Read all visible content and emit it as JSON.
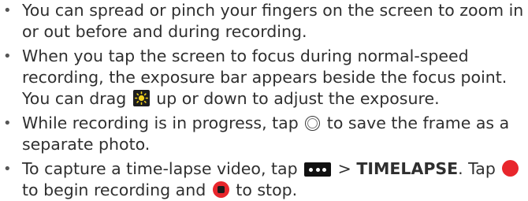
{
  "bullet_symbol": "•",
  "items": [
    {
      "text": "You can spread or pinch your fingers on the screen to zoom in or out before and during recording."
    },
    {
      "text_a": "When you tap the screen to focus during normal-speed recording, the exposure bar appears beside the focus point. You can drag",
      "icon": "exposure-sun-icon",
      "text_b": "up or down to adjust the exposure."
    },
    {
      "text_a": "While recording is in progress, tap",
      "icon": "shutter-icon",
      "text_b": "to save the frame as a separate photo."
    },
    {
      "text_a": "To capture a time-lapse video, tap",
      "icon_1": "more-icon",
      "sep": ">",
      "bold": "TIMELAPSE",
      "text_b": ". Tap",
      "icon_2": "record-icon",
      "text_c": "to begin recording and",
      "icon_3": "stop-icon",
      "text_d": "to stop."
    }
  ]
}
